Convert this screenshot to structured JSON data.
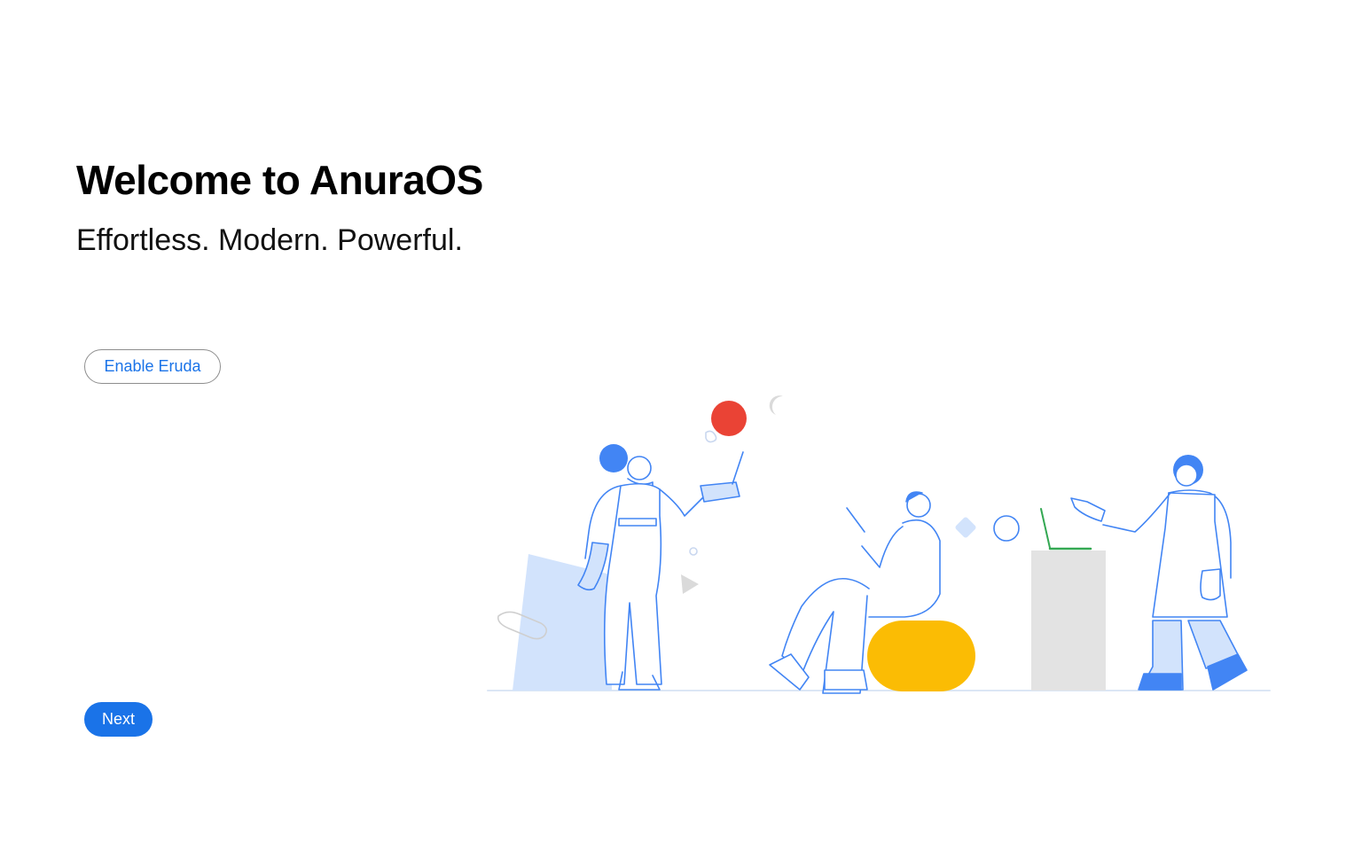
{
  "welcome": {
    "title": "Welcome to AnuraOS",
    "subtitle": "Effortless. Modern. Powerful."
  },
  "buttons": {
    "enable_eruda": "Enable Eruda",
    "next": "Next"
  },
  "colors": {
    "accent": "#1a73e8",
    "illustration_stroke": "#4285f4",
    "illustration_fill_light": "#d2e3fc",
    "red": "#ea4335",
    "yellow": "#fbbc04",
    "green": "#34a853",
    "grey": "#e3e3e3"
  },
  "illustration": {
    "icon": "people-working-illustration"
  }
}
